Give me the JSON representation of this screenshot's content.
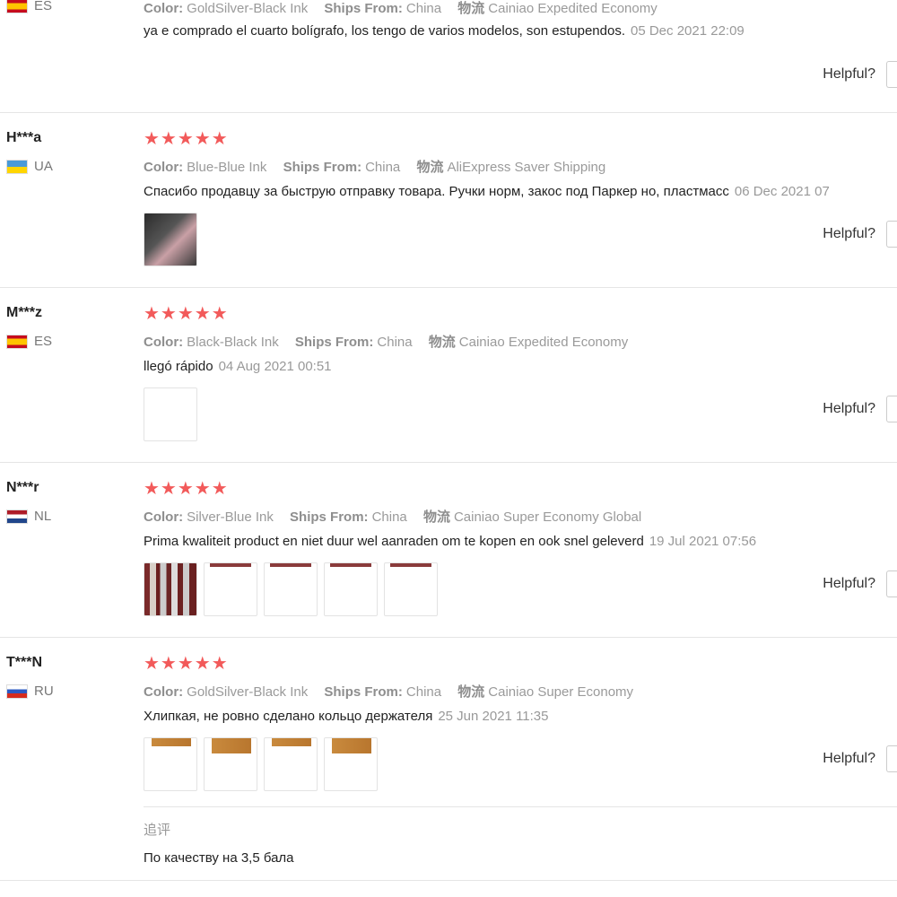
{
  "helpful_label": "Helpful?",
  "colors": {
    "star": "#f25a5a",
    "divider": "#e5e5e5",
    "meta": "#999999"
  },
  "labels": {
    "color": "Color:",
    "ships_from": "Ships From:",
    "logistics": "物流"
  },
  "reviews": [
    {
      "country": "ES",
      "color": "GoldSilver-Black Ink",
      "ships_from": "China",
      "logistics": "Cainiao Expedited Economy",
      "text": "ya e comprado el cuarto bolígrafo, los tengo de varios modelos, son estupendos.",
      "date": "05 Dec 2021 22:09"
    },
    {
      "user": "H***a",
      "country": "UA",
      "stars": "★★★★★",
      "color": "Blue-Blue Ink",
      "ships_from": "China",
      "logistics": "AliExpress Saver Shipping",
      "text": "Спасибо продавцу за быструю отправку товара. Ручки норм, закос под Паркер но, пластмасс",
      "date": "06 Dec 2021 07",
      "photos": [
        "photo"
      ]
    },
    {
      "user": "M***z",
      "country": "ES",
      "stars": "★★★★★",
      "color": "Black-Black Ink",
      "ships_from": "China",
      "logistics": "Cainiao Expedited Economy",
      "text": "llegó rápido",
      "date": "04 Aug 2021 00:51",
      "photos": [
        "photo"
      ]
    },
    {
      "user": "N***r",
      "country": "NL",
      "stars": "★★★★★",
      "color": "Silver-Blue Ink",
      "ships_from": "China",
      "logistics": "Cainiao Super Economy Global",
      "text": "Prima kwaliteit product en niet duur wel aanraden om te kopen en ook snel geleverd",
      "date": "19 Jul 2021 07:56",
      "photos": [
        "photo",
        "photo",
        "photo",
        "photo",
        "photo"
      ]
    },
    {
      "user": "T***N",
      "country": "RU",
      "stars": "★★★★★",
      "color": "GoldSilver-Black Ink",
      "ships_from": "China",
      "logistics": "Cainiao Super Economy",
      "text": "Хлипкая, не ровно сделано кольцо держателя",
      "date": "25 Jun 2021 11:35",
      "photos": [
        "photo",
        "photo",
        "photo",
        "photo"
      ],
      "followup_title": "追评",
      "followup_text": "По качеству на 3,5 бала"
    }
  ]
}
